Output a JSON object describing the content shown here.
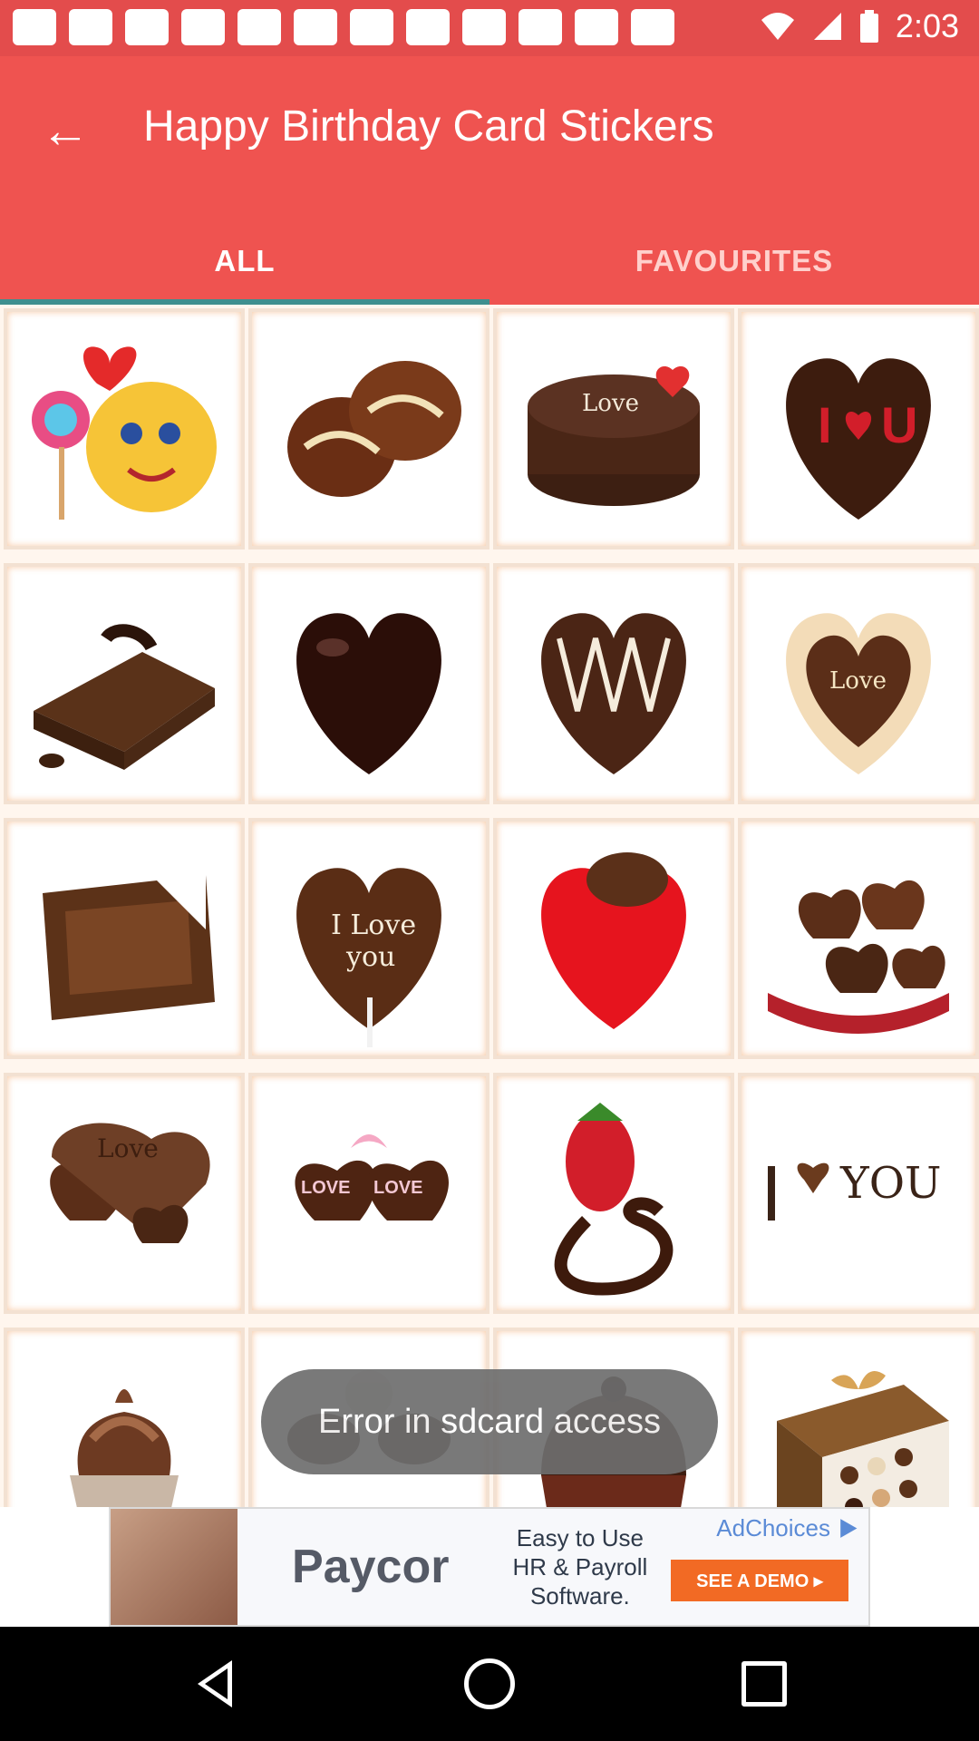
{
  "status_bar": {
    "time": "2:03",
    "icons": [
      "more-dots-icon",
      "facebook-icon",
      "app-icon",
      "app-icon",
      "app-icon",
      "app-icon",
      "app-icon",
      "app-icon",
      "app-icon",
      "app-icon",
      "facebook-icon",
      "app-icon",
      "wifi-icon",
      "signal-icon",
      "battery-icon"
    ]
  },
  "app_bar": {
    "title": "Happy Birthday Card Stickers",
    "back_icon": "arrow-back-icon"
  },
  "tabs": [
    {
      "label": "ALL",
      "active": true
    },
    {
      "label": "FAVOURITES",
      "active": false
    }
  ],
  "stickers": [
    {
      "name": "emoji-lollipop-heart"
    },
    {
      "name": "chocolate-hearts-drizzle"
    },
    {
      "name": "chocolate-cake-love-u"
    },
    {
      "name": "i-heart-u-chocolate"
    },
    {
      "name": "chocolate-cake-slice"
    },
    {
      "name": "dark-chocolate-heart"
    },
    {
      "name": "heart-cake-white-drizzle"
    },
    {
      "name": "love-heart-cookie"
    },
    {
      "name": "chocolate-bar-bitten"
    },
    {
      "name": "i-love-you-lollipop"
    },
    {
      "name": "red-heart-chocolate-cup"
    },
    {
      "name": "box-of-chocolate-hearts"
    },
    {
      "name": "love-chocolate-hearts"
    },
    {
      "name": "love-you-heart-cookies"
    },
    {
      "name": "strawberry-chocolate-heart"
    },
    {
      "name": "i-love-you-chocolate-letters"
    },
    {
      "name": "chocolate-cupcake"
    },
    {
      "name": "white-chocolate-truffles"
    },
    {
      "name": "chocolate-muffin"
    },
    {
      "name": "chocolate-gift-box"
    }
  ],
  "toast": {
    "text": "Error in sdcard access"
  },
  "ad": {
    "brand": "Paycor",
    "copy_lines": [
      "Easy to Use",
      "HR & Payroll",
      "Software."
    ],
    "cta": "SEE A DEMO ▸",
    "adchoices": "AdChoices"
  },
  "nav_bar": {
    "buttons": [
      "back-icon",
      "home-icon",
      "recents-icon"
    ]
  },
  "colors": {
    "accent": "#ef5350",
    "status_bar": "#e34c4c",
    "indicator": "#3f8f8f",
    "toast": "#6e6e6e"
  }
}
